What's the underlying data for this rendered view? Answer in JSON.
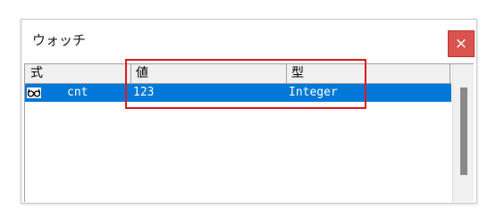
{
  "window": {
    "title": "ウォッチ",
    "close_label": "×"
  },
  "watch_list": {
    "columns": [
      "式",
      "値",
      "型"
    ],
    "rows": [
      {
        "icon": "glasses-icon",
        "expression": "cnt",
        "value": "123",
        "type": "Integer",
        "selected": true
      }
    ]
  },
  "colors": {
    "selection": "#0078d7",
    "close_button": "#d9534f",
    "highlight": "#e0191c"
  }
}
